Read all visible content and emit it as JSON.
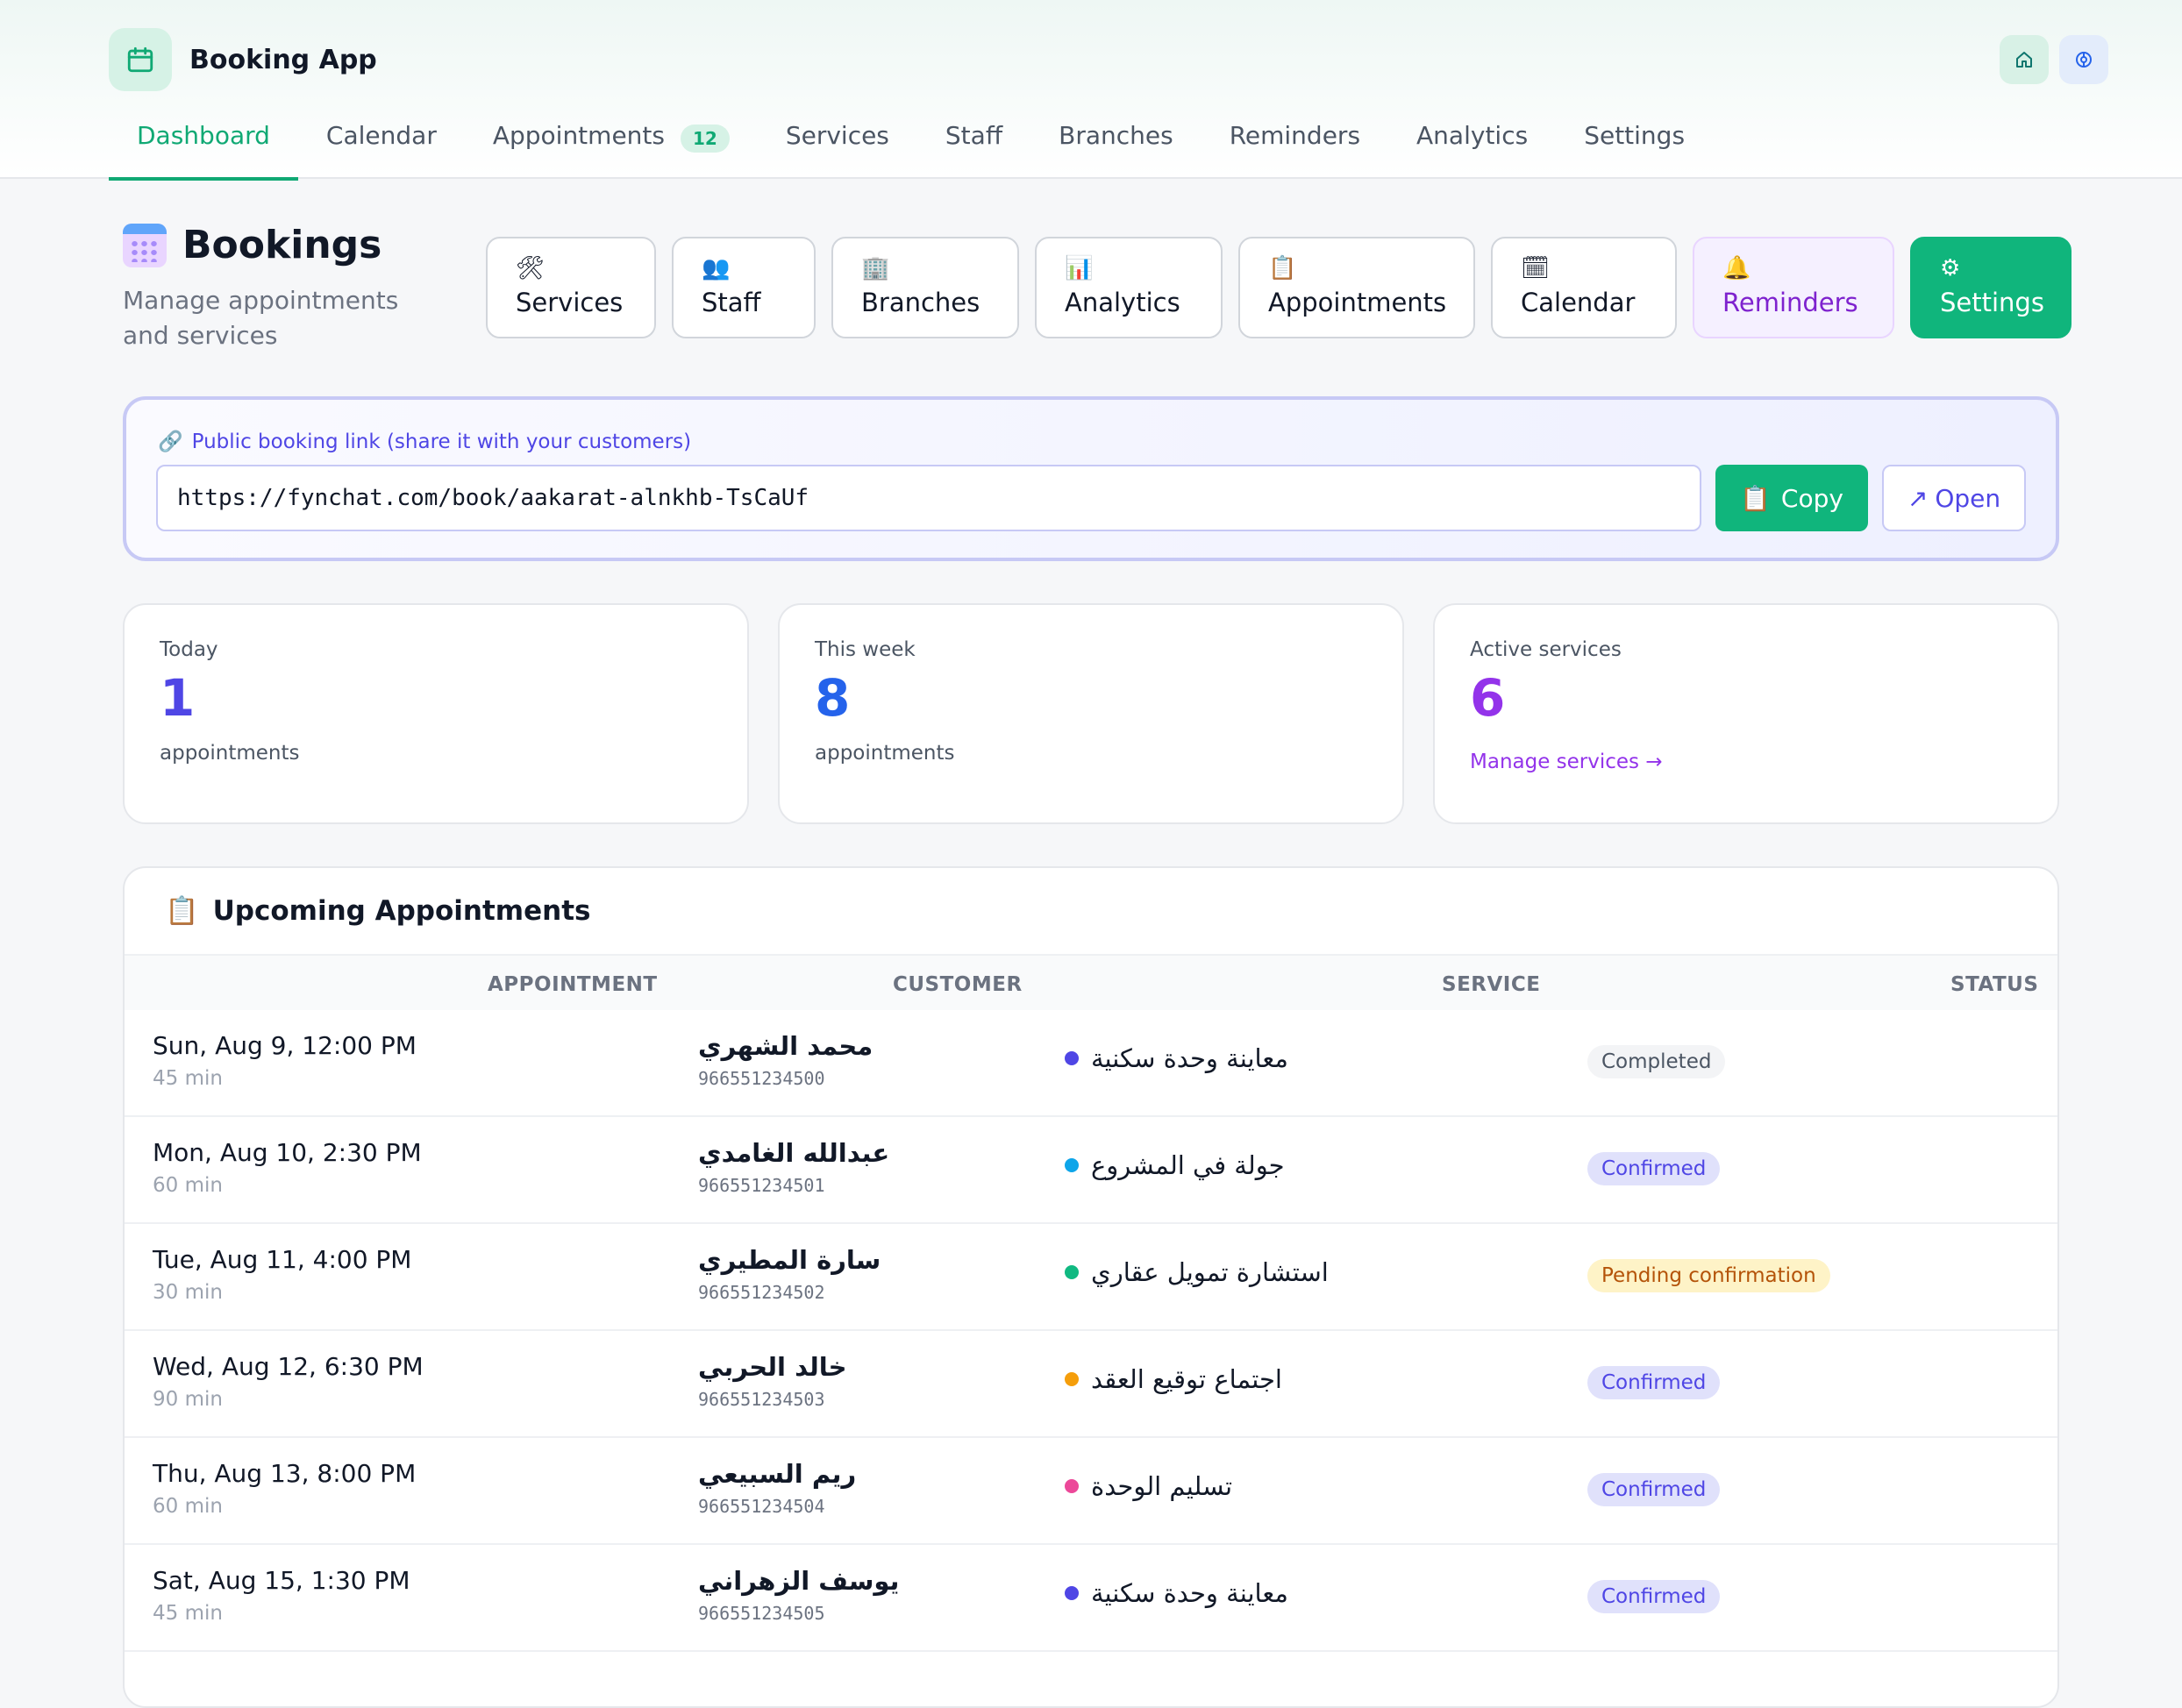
{
  "app": {
    "name": "Booking App"
  },
  "nav": [
    {
      "label": "Dashboard",
      "active": true
    },
    {
      "label": "Calendar"
    },
    {
      "label": "Appointments",
      "badge": "12"
    },
    {
      "label": "Services"
    },
    {
      "label": "Staff"
    },
    {
      "label": "Branches"
    },
    {
      "label": "Reminders"
    },
    {
      "label": "Analytics"
    },
    {
      "label": "Settings"
    }
  ],
  "header": {
    "title": "Bookings",
    "subtitle": "Manage appointments and services"
  },
  "quick_actions": [
    {
      "label": "Services",
      "icon": "🛠"
    },
    {
      "label": "Staff",
      "icon": "👥"
    },
    {
      "label": "Branches",
      "icon": "🏢"
    },
    {
      "label": "Analytics",
      "icon": "📊"
    },
    {
      "label": "Appointments",
      "icon": "📋"
    },
    {
      "label": "Calendar",
      "icon": "🗓"
    },
    {
      "label": "Reminders",
      "icon": "🔔"
    },
    {
      "label": "Settings",
      "icon": "⚙"
    }
  ],
  "public_link": {
    "label": "Public booking link (share it with your customers)",
    "url": "https://fynchat.com/book/aakarat-alnkhb-TsCaUf",
    "copy_label": "Copy",
    "open_label": "Open"
  },
  "stats": [
    {
      "label": "Today",
      "value": "1",
      "sub": "appointments",
      "color": "#4f46e5"
    },
    {
      "label": "This week",
      "value": "8",
      "sub": "appointments",
      "color": "#2563eb"
    },
    {
      "label": "Active services",
      "value": "6",
      "link": "Manage services →",
      "color": "#9333ea"
    }
  ],
  "upcoming": {
    "title": "Upcoming Appointments",
    "columns": [
      "APPOINTMENT",
      "CUSTOMER",
      "SERVICE",
      "STATUS"
    ],
    "rows": [
      {
        "date": "Sun, Aug 9, 12:00 PM",
        "duration": "45 min",
        "customer": "محمد الشهري",
        "phone": "966551234500",
        "service": "معاينة وحدة سكنية",
        "dot": "#4f46e5",
        "status": "Completed",
        "status_kind": "completed"
      },
      {
        "date": "Mon, Aug 10, 2:30 PM",
        "duration": "60 min",
        "customer": "عبدالله الغامدي",
        "phone": "966551234501",
        "service": "جولة في المشروع",
        "dot": "#0ea5e9",
        "status": "Confirmed",
        "status_kind": "confirmed"
      },
      {
        "date": "Tue, Aug 11, 4:00 PM",
        "duration": "30 min",
        "customer": "سارة المطيري",
        "phone": "966551234502",
        "service": "استشارة تمويل عقاري",
        "dot": "#10b981",
        "status": "Pending confirmation",
        "status_kind": "pending"
      },
      {
        "date": "Wed, Aug 12, 6:30 PM",
        "duration": "90 min",
        "customer": "خالد الحربي",
        "phone": "966551234503",
        "service": "اجتماع توقيع العقد",
        "dot": "#f59e0b",
        "status": "Confirmed",
        "status_kind": "confirmed"
      },
      {
        "date": "Thu, Aug 13, 8:00 PM",
        "duration": "60 min",
        "customer": "ريم السبيعي",
        "phone": "966551234504",
        "service": "تسليم الوحدة",
        "dot": "#ec4899",
        "status": "Confirmed",
        "status_kind": "confirmed"
      },
      {
        "date": "Sat, Aug 15, 1:30 PM",
        "duration": "45 min",
        "customer": "يوسف الزهراني",
        "phone": "966551234505",
        "service": "معاينة وحدة سكنية",
        "dot": "#4f46e5",
        "status": "Confirmed",
        "status_kind": "confirmed"
      }
    ]
  }
}
